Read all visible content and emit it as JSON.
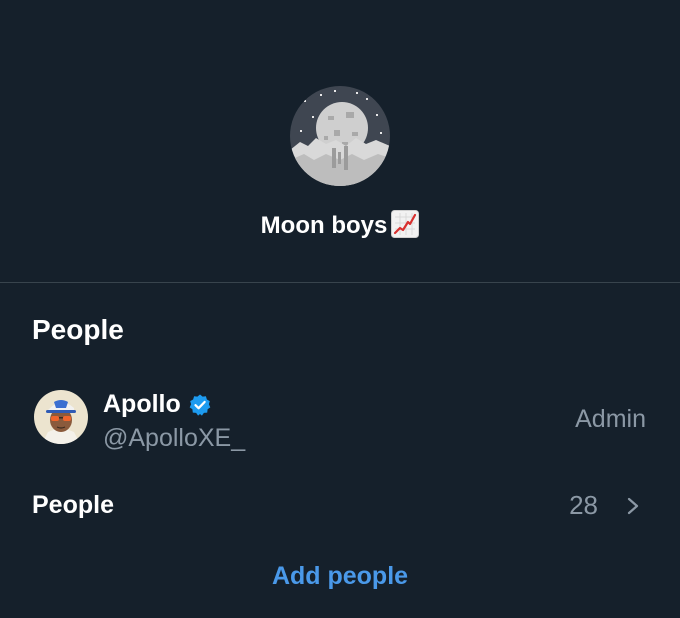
{
  "group": {
    "name": "Moon boys",
    "name_emoji_icon": "chart-increasing-icon",
    "avatar_icon": "moon-pixel-art-icon"
  },
  "people_section": {
    "title": "People",
    "members": [
      {
        "name": "Apollo",
        "verified": true,
        "verified_icon": "verified-badge-icon",
        "handle": "@ApolloXE_",
        "role": "Admin",
        "avatar_icon": "cartoon-avatar-icon"
      }
    ],
    "people_row": {
      "label": "People",
      "count": "28",
      "chevron_icon": "chevron-right-icon"
    },
    "add_people_label": "Add people"
  },
  "colors": {
    "background": "#15202b",
    "divider": "#38444d",
    "secondary_text": "#8b98a5",
    "accent": "#4a99e9",
    "verified": "#1d9bf0"
  }
}
